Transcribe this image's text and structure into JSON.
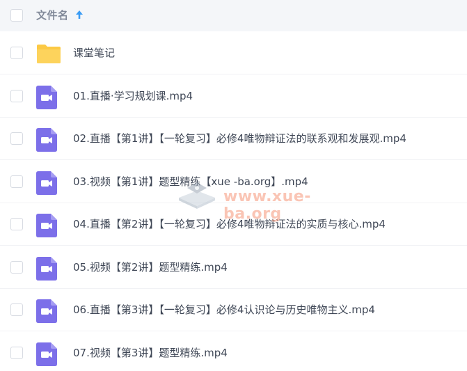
{
  "header": {
    "column_label": "文件名",
    "sort": "ascending"
  },
  "colors": {
    "folder": "#fcc944",
    "video": "#7c6fe9",
    "sort_arrow": "#3a9cf5",
    "header_bg": "#f4f6f9"
  },
  "files": [
    {
      "type": "folder",
      "icon": "folder-icon",
      "name": "课堂笔记"
    },
    {
      "type": "video",
      "icon": "video-icon",
      "name": "01.直播·学习规划课.mp4"
    },
    {
      "type": "video",
      "icon": "video-icon",
      "name": "02.直播【第1讲】【一轮复习】必修4唯物辩证法的联系观和发展观.mp4"
    },
    {
      "type": "video",
      "icon": "video-icon",
      "name": "03.视频【第1讲】题型精练【xue -ba.org】.mp4"
    },
    {
      "type": "video",
      "icon": "video-icon",
      "name": "04.直播【第2讲】【一轮复习】必修4唯物辩证法的实质与核心.mp4"
    },
    {
      "type": "video",
      "icon": "video-icon",
      "name": "05.视频【第2讲】题型精练.mp4"
    },
    {
      "type": "video",
      "icon": "video-icon",
      "name": "06.直播【第3讲】【一轮复习】必修4认识论与历史唯物主义.mp4"
    },
    {
      "type": "video",
      "icon": "video-icon",
      "name": "07.视频【第3讲】题型精练.mp4"
    }
  ],
  "watermark": {
    "text": "www.xue-ba.org"
  }
}
